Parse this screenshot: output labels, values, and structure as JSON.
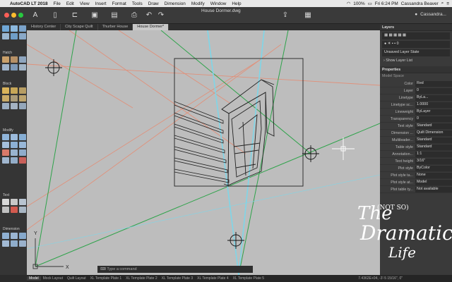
{
  "menubar": {
    "app": "AutoCAD LT 2018",
    "items": [
      "File",
      "Edit",
      "View",
      "Insert",
      "Format",
      "Tools",
      "Draw",
      "Dimension",
      "Modify",
      "Window",
      "Help"
    ],
    "battery": "100%",
    "clock": "Fri 6:24 PM",
    "user": "Cassandra Beaver"
  },
  "titlebar": {
    "document": "House Dormer.dwg",
    "user": "Cassandra..."
  },
  "tabs": [
    "History Center",
    "City Scape Quilt",
    "Thurber House",
    "House Dormer*"
  ],
  "toolpanel": {
    "sections": [
      "Hatch",
      "Block",
      "Modify",
      "Text",
      "Dimension"
    ]
  },
  "layers": {
    "header": "Layers",
    "current": "0",
    "state": "Unsaved Layer State",
    "show_list": "Show Layer List"
  },
  "properties": {
    "header": "Properties",
    "section": "Model Space",
    "rows": [
      {
        "k": "Color",
        "v": "Red"
      },
      {
        "k": "Layer",
        "v": "0"
      },
      {
        "k": "Linetype",
        "v": "ByLa..."
      },
      {
        "k": "Linetype sc...",
        "v": "1.0000"
      },
      {
        "k": "Lineweight",
        "v": "ByLayer"
      },
      {
        "k": "Transparency",
        "v": "0"
      },
      {
        "k": "Text style",
        "v": "Standard"
      },
      {
        "k": "Dimension ...",
        "v": "Quilt Dimension"
      },
      {
        "k": "Multileader...",
        "v": "Standard"
      },
      {
        "k": "Table style",
        "v": "Standard"
      },
      {
        "k": "Annotation...",
        "v": "1:1"
      },
      {
        "k": "Text height",
        "v": "3/16\""
      },
      {
        "k": "Plot style",
        "v": "ByColor"
      },
      {
        "k": "Plot style ta...",
        "v": "None"
      },
      {
        "k": "Plot style at...",
        "v": "Model"
      },
      {
        "k": "Plot table ty...",
        "v": "Not available"
      }
    ]
  },
  "command": {
    "placeholder": "Type a command"
  },
  "statusbar": {
    "tabs": [
      "Model",
      "Mock Layout",
      "Quilt Layout",
      "XL Template Plate 1",
      "XL Template Plate 2",
      "XL Template Plate 3",
      "XL Template Plate 4",
      "XL Template Plate 5"
    ],
    "coords": "7.4362E+04, -3'-5 15/16\", 0\"",
    "scale": "1:1"
  },
  "canvas": {
    "ucs_y": "Y",
    "ucs_x": "X"
  },
  "watermark": {
    "line1": "The",
    "line2": "(NOT SO)",
    "line3": "Dramatic",
    "line4": "Life"
  },
  "colors": {
    "accent": "#2f7fd9",
    "canvas": "#bdbdbd",
    "green_line": "#2ea34a",
    "orange_line": "#e38a6a",
    "cyan_line": "#7fd6e8"
  }
}
